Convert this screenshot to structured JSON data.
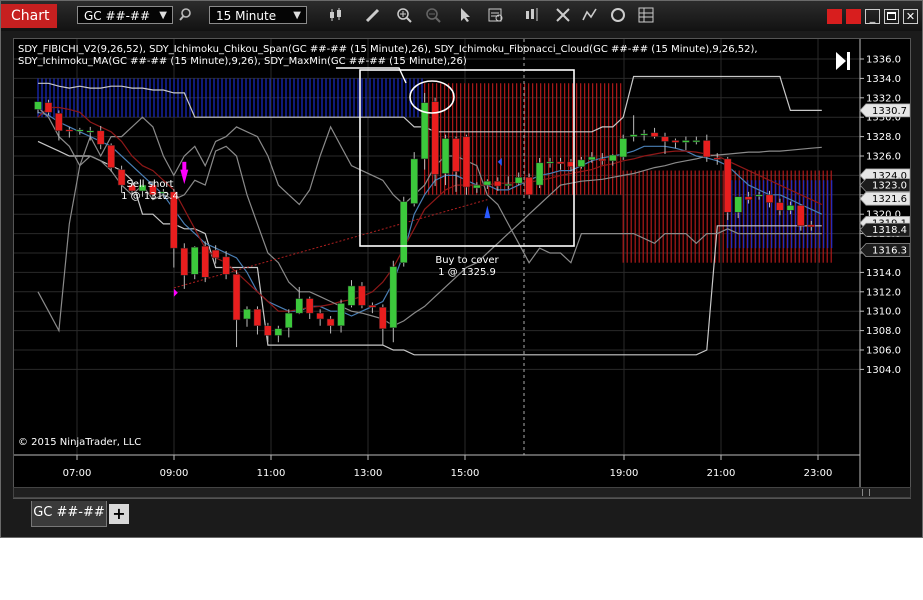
{
  "window": {
    "title": "Chart"
  },
  "toolbar": {
    "instrument": "GC ##-##",
    "interval": "15 Minute",
    "icons": [
      "search-icon",
      "bar-type-icon",
      "pencil-icon",
      "zoom-in-icon",
      "zoom-out-icon",
      "pointer-icon",
      "data-box-icon",
      "chart-style-icon",
      "properties-icon",
      "indicators-icon",
      "reload-icon",
      "grid-menu-icon"
    ]
  },
  "chart": {
    "indicator_label": "SDY_FIBICHI_V2(9,26,52), SDY_Ichimoku_Chikou_Span(GC ##-## (15 Minute),26), SDY_Ichimoku_Fibonacci_Cloud(GC ##-## (15 Minute),9,26,52), SDY_Ichimoku_MA(GC ##-## (15 Minute),9,26), SDY_MaxMin(GC ##-## (15 Minute),26)",
    "copyright": "© 2015 NinjaTrader, LLC",
    "sell_label": "Sell short",
    "sell_fill": "1 @ 1312.4",
    "buy_label": "Buy to cover",
    "buy_fill": "1 @ 1325.9"
  },
  "chart_data": {
    "type": "candlestick",
    "x_tick_labels": [
      "07:00",
      "09:00",
      "11:00",
      "13:00",
      "15:00",
      "19:00",
      "21:00",
      "23:00"
    ],
    "y_tick_labels": [
      "1336.0",
      "1334.0",
      "1332.0",
      "1330.0",
      "1328.0",
      "1326.0",
      "1324.0",
      "1322.0",
      "1320.0",
      "1318.0",
      "1316.0",
      "1314.0",
      "1312.0",
      "1310.0",
      "1308.0",
      "1306.0",
      "1304.0"
    ],
    "ylim": [
      1303.5,
      1337
    ],
    "grid": true,
    "price_markers": [
      {
        "value": 1330.7,
        "label": "1330.7",
        "style": "light"
      },
      {
        "value": 1324.0,
        "label": "1324.0",
        "style": "light"
      },
      {
        "value": 1323.0,
        "label": "1323.0",
        "style": "dark"
      },
      {
        "value": 1321.6,
        "label": "1321.6",
        "style": "light"
      },
      {
        "value": 1319.1,
        "label": "1319.1",
        "style": "light"
      },
      {
        "value": 1318.4,
        "label": "1318.4",
        "style": "dark"
      },
      {
        "value": 1316.3,
        "label": "1316.3",
        "style": "dark"
      }
    ],
    "candles": [
      {
        "o": 1330.8,
        "h": 1331.2,
        "c": 1331.6,
        "l": 1330.4
      },
      {
        "o": 1331.5,
        "h": 1331.8,
        "c": 1330.5,
        "l": 1330.2
      },
      {
        "o": 1330.4,
        "h": 1330.7,
        "c": 1328.6,
        "l": 1327.6
      },
      {
        "o": 1328.7,
        "h": 1329.0,
        "c": 1328.6,
        "l": 1327.9
      },
      {
        "o": 1328.6,
        "h": 1328.9,
        "c": 1328.7,
        "l": 1328.2
      },
      {
        "o": 1328.6,
        "h": 1329.0,
        "c": 1328.6,
        "l": 1327.6
      },
      {
        "o": 1328.6,
        "h": 1329.1,
        "c": 1327.2,
        "l": 1326.7
      },
      {
        "o": 1327.1,
        "h": 1327.3,
        "c": 1324.8,
        "l": 1324.4
      },
      {
        "o": 1324.6,
        "h": 1325.0,
        "c": 1323.0,
        "l": 1322.2
      },
      {
        "o": 1323.0,
        "h": 1323.5,
        "c": 1322.4,
        "l": 1321.9
      },
      {
        "o": 1322.4,
        "h": 1323.0,
        "c": 1323.0,
        "l": 1321.8
      },
      {
        "o": 1323.0,
        "h": 1323.4,
        "c": 1322.0,
        "l": 1321.5
      },
      {
        "o": 1322.2,
        "h": 1322.6,
        "c": 1322.3,
        "l": 1321.7
      },
      {
        "o": 1322.3,
        "h": 1322.6,
        "c": 1316.5,
        "l": 1314.5
      },
      {
        "o": 1316.5,
        "h": 1317.0,
        "c": 1313.7,
        "l": 1312.3
      },
      {
        "o": 1313.8,
        "h": 1316.7,
        "c": 1316.6,
        "l": 1313.3
      },
      {
        "o": 1316.7,
        "h": 1317.2,
        "c": 1313.5,
        "l": 1313.0
      },
      {
        "o": 1316.3,
        "h": 1316.8,
        "c": 1315.5,
        "l": 1314.9
      },
      {
        "o": 1315.6,
        "h": 1316.2,
        "c": 1313.8,
        "l": 1313.3
      },
      {
        "o": 1313.8,
        "h": 1314.2,
        "c": 1309.1,
        "l": 1306.3
      },
      {
        "o": 1309.2,
        "h": 1310.5,
        "c": 1310.2,
        "l": 1308.4
      },
      {
        "o": 1310.2,
        "h": 1310.5,
        "c": 1308.5,
        "l": 1307.6
      },
      {
        "o": 1308.5,
        "h": 1308.8,
        "c": 1307.5,
        "l": 1306.8
      },
      {
        "o": 1307.5,
        "h": 1308.5,
        "c": 1308.2,
        "l": 1306.8
      },
      {
        "o": 1308.3,
        "h": 1310.2,
        "c": 1309.8,
        "l": 1307.3
      },
      {
        "o": 1309.8,
        "h": 1312.5,
        "c": 1311.3,
        "l": 1309.7
      },
      {
        "o": 1311.3,
        "h": 1311.5,
        "c": 1309.8,
        "l": 1309.2
      },
      {
        "o": 1309.8,
        "h": 1310.2,
        "c": 1309.2,
        "l": 1308.5
      },
      {
        "o": 1309.2,
        "h": 1309.5,
        "c": 1308.5,
        "l": 1307.7
      },
      {
        "o": 1308.5,
        "h": 1311.2,
        "c": 1310.8,
        "l": 1307.8
      },
      {
        "o": 1310.6,
        "h": 1313.2,
        "c": 1312.6,
        "l": 1310.4
      },
      {
        "o": 1312.6,
        "h": 1313.0,
        "c": 1310.6,
        "l": 1310.3
      },
      {
        "o": 1310.6,
        "h": 1310.9,
        "c": 1310.4,
        "l": 1309.8
      },
      {
        "o": 1310.4,
        "h": 1310.7,
        "c": 1308.2,
        "l": 1306.5
      },
      {
        "o": 1308.3,
        "h": 1315.2,
        "c": 1314.6,
        "l": 1306.8
      },
      {
        "o": 1315.0,
        "h": 1321.8,
        "c": 1321.3,
        "l": 1314.6
      },
      {
        "o": 1321.1,
        "h": 1326.4,
        "c": 1325.7,
        "l": 1320.8
      },
      {
        "o": 1325.7,
        "h": 1332.5,
        "c": 1331.5,
        "l": 1324.6
      },
      {
        "o": 1331.6,
        "h": 1332.0,
        "c": 1324.1,
        "l": 1322.9
      },
      {
        "o": 1324.2,
        "h": 1328.2,
        "c": 1327.8,
        "l": 1323.0
      },
      {
        "o": 1327.8,
        "h": 1328.0,
        "c": 1324.4,
        "l": 1322.3
      },
      {
        "o": 1328.0,
        "h": 1328.2,
        "c": 1322.8,
        "l": 1322.0
      },
      {
        "o": 1322.7,
        "h": 1323.3,
        "c": 1323.0,
        "l": 1322.2
      },
      {
        "o": 1323.0,
        "h": 1323.6,
        "c": 1323.4,
        "l": 1322.6
      },
      {
        "o": 1323.4,
        "h": 1323.8,
        "c": 1322.9,
        "l": 1322.4
      },
      {
        "o": 1323.1,
        "h": 1323.9,
        "c": 1323.1,
        "l": 1322.6
      },
      {
        "o": 1323.2,
        "h": 1324.3,
        "c": 1323.8,
        "l": 1323.0
      },
      {
        "o": 1323.8,
        "h": 1324.2,
        "c": 1322.0,
        "l": 1321.6
      },
      {
        "o": 1323.0,
        "h": 1325.8,
        "c": 1325.3,
        "l": 1322.7
      },
      {
        "o": 1325.3,
        "h": 1325.8,
        "c": 1325.4,
        "l": 1324.8
      },
      {
        "o": 1325.4,
        "h": 1325.8,
        "c": 1325.2,
        "l": 1324.6
      },
      {
        "o": 1325.4,
        "h": 1325.7,
        "c": 1324.9,
        "l": 1324.4
      },
      {
        "o": 1324.9,
        "h": 1325.9,
        "c": 1325.6,
        "l": 1324.7
      },
      {
        "o": 1325.6,
        "h": 1326.4,
        "c": 1325.9,
        "l": 1325.3
      },
      {
        "o": 1325.7,
        "h": 1326.3,
        "c": 1325.5,
        "l": 1325.1
      },
      {
        "o": 1325.5,
        "h": 1326.2,
        "c": 1326.1,
        "l": 1325.0
      },
      {
        "o": 1325.9,
        "h": 1328.2,
        "c": 1327.8,
        "l": 1325.6
      },
      {
        "o": 1328.0,
        "h": 1330.2,
        "c": 1328.2,
        "l": 1327.5
      },
      {
        "o": 1328.2,
        "h": 1328.7,
        "c": 1328.3,
        "l": 1327.6
      },
      {
        "o": 1328.4,
        "h": 1328.9,
        "c": 1328.0,
        "l": 1327.8
      },
      {
        "o": 1328.0,
        "h": 1328.4,
        "c": 1327.5,
        "l": 1326.2
      },
      {
        "o": 1327.6,
        "h": 1327.8,
        "c": 1327.4,
        "l": 1326.8
      },
      {
        "o": 1327.4,
        "h": 1328.0,
        "c": 1327.6,
        "l": 1326.6
      },
      {
        "o": 1327.6,
        "h": 1328.0,
        "c": 1327.6,
        "l": 1327.2
      },
      {
        "o": 1327.6,
        "h": 1328.2,
        "c": 1325.9,
        "l": 1325.4
      },
      {
        "o": 1325.8,
        "h": 1326.3,
        "c": 1325.7,
        "l": 1325.1
      },
      {
        "o": 1325.7,
        "h": 1325.9,
        "c": 1320.2,
        "l": 1319.4
      },
      {
        "o": 1320.2,
        "h": 1321.8,
        "c": 1321.8,
        "l": 1319.6
      },
      {
        "o": 1321.8,
        "h": 1322.3,
        "c": 1321.5,
        "l": 1321.1
      },
      {
        "o": 1321.9,
        "h": 1322.3,
        "c": 1322.0,
        "l": 1321.5
      },
      {
        "o": 1322.0,
        "h": 1322.4,
        "c": 1321.2,
        "l": 1320.7
      },
      {
        "o": 1321.2,
        "h": 1321.6,
        "c": 1320.4,
        "l": 1319.9
      },
      {
        "o": 1320.4,
        "h": 1321.3,
        "c": 1320.9,
        "l": 1320.0
      },
      {
        "o": 1320.9,
        "h": 1321.0,
        "c": 1318.8,
        "l": 1318.3
      },
      {
        "o": 1318.9,
        "h": 1319.3,
        "c": 1318.7,
        "l": 1318.3
      }
    ],
    "series": [
      {
        "style": "light-gray",
        "values": [
          1333.5,
          1333.5,
          1333.2,
          1333.0,
          1333.2,
          1333.0,
          1333.0,
          1333.2,
          1333.2,
          1333.0,
          1333.0,
          1332.8,
          1332.8,
          1332.5,
          1332.5,
          1330.0,
          1330.0,
          1330.0,
          1330.0,
          1330.0,
          1330.0,
          1330.0,
          1330.0,
          1330.0,
          1330.0,
          1330.0,
          1330.0,
          1330.0,
          1330.0,
          1330.0,
          1330.0,
          1330.0,
          1330.0,
          1330.0,
          1330.0,
          1330.0,
          1329.0,
          1329.0,
          1328.5,
          1328.5,
          1328.5,
          1328.5,
          1328.5,
          1328.5,
          1328.5,
          1328.5,
          1328.5,
          1328.5,
          1328.5,
          1328.5,
          1328.5,
          1328.5,
          1328.5,
          1328.5,
          1329.0,
          1329.0,
          1330.0,
          1334.2,
          1334.2,
          1334.2,
          1334.2,
          1334.2,
          1334.2,
          1334.2,
          1334.2,
          1334.2,
          1334.2,
          1334.2,
          1334.2,
          1334.2,
          1334.2,
          1334.2,
          1330.7,
          1330.7,
          1330.7,
          1330.7
        ]
      },
      {
        "style": "light-gray",
        "values": [
          1327.5,
          1327.0,
          1326.5,
          1326.0,
          1326.0,
          1326.0,
          1325.5,
          1325.0,
          1324.5,
          1323.5,
          1320.0,
          1320.0,
          1319.0,
          1319.0,
          1318.5,
          1318.5,
          1318.0,
          1314.5,
          1314.5,
          1314.5,
          1314.5,
          1314.5,
          1306.5,
          1306.5,
          1306.5,
          1306.5,
          1306.5,
          1306.5,
          1306.5,
          1306.5,
          1306.5,
          1306.5,
          1306.5,
          1306.5,
          1306.0,
          1306.0,
          1305.5,
          1305.5,
          1305.5,
          1305.5,
          1305.5,
          1305.5,
          1305.5,
          1305.5,
          1305.5,
          1305.5,
          1305.5,
          1305.5,
          1305.5,
          1305.5,
          1305.5,
          1305.5,
          1305.5,
          1305.5,
          1305.5,
          1305.5,
          1305.5,
          1305.5,
          1305.5,
          1305.5,
          1305.5,
          1305.5,
          1305.5,
          1305.5,
          1306.0,
          1318.8,
          1318.8,
          1318.8,
          1318.8,
          1318.8,
          1318.8,
          1318.8,
          1318.8,
          1318.8,
          1318.8,
          1318.8
        ]
      },
      {
        "style": "gray",
        "values": [
          1312.0,
          1310.0,
          1308.0,
          1319.0,
          1325.0,
          1328.0,
          1326.0,
          1328.0,
          1328.0,
          1329.0,
          1330.0,
          1329.0,
          1326.0,
          1324.0,
          1326.0,
          1327.0,
          1325.0,
          1327.5,
          1328.0,
          1329.0,
          1328.5,
          1328.0,
          1326.0,
          1323.0,
          1322.0,
          1321.0,
          1322.5,
          1326.0,
          1329.0,
          1327.0,
          1325.0,
          1324.5,
          1324.0,
          1323.5,
          1322.0,
          1321.0,
          1322.0,
          1323.0,
          1325.0,
          1326.0,
          1326.0,
          1325.5,
          1325.0,
          1322.0,
          1321.0,
          1319.0,
          1317.0,
          1315.0,
          1316.5,
          1316.0,
          1316.0,
          1315.0,
          1318.0,
          1318.0,
          1318.0,
          1318.0,
          1318.0,
          1318.0,
          1317.5,
          1317.0,
          1318.0,
          1318.0,
          1318.0,
          1317.0,
          1318.0,
          1318.0,
          1318.5,
          1318.0,
          1318.0,
          1318.0,
          1318.0,
          1318.0,
          1318.0,
          1318.0,
          1318.0,
          1318.0
        ]
      },
      {
        "style": "blue",
        "values": [
          1330.5,
          1330.2,
          1329.5,
          1329.0,
          1328.5,
          1328.0,
          1327.5,
          1327.0,
          1326.0,
          1325.0,
          1324.0,
          1323.0,
          1322.0,
          1320.5,
          1319.0,
          1318.0,
          1317.0,
          1316.5,
          1316.0,
          1315.5,
          1314.0,
          1312.0,
          1311.0,
          1310.5,
          1310.0,
          1310.0,
          1310.5,
          1310.5,
          1310.0,
          1310.0,
          1309.5,
          1310.0,
          1310.5,
          1311.0,
          1313.0,
          1316.0,
          1320.0,
          1322.0,
          1323.5,
          1324.0,
          1324.0,
          1323.5,
          1323.0,
          1323.0,
          1322.5,
          1322.5,
          1323.0,
          1323.5,
          1324.0,
          1324.2,
          1324.5,
          1324.5,
          1325.0,
          1325.5,
          1325.8,
          1326.0,
          1326.2,
          1326.5,
          1327.0,
          1327.0,
          1327.0,
          1326.8,
          1326.5,
          1326.0,
          1325.8,
          1325.5,
          1325.0,
          1324.0,
          1323.0,
          1322.5,
          1322.0,
          1322.0,
          1321.5,
          1321.0,
          1320.5,
          1320.0
        ]
      },
      {
        "style": "dark-red",
        "values": [
          1330.0,
          1331.0,
          1331.0,
          1330.8,
          1330.5,
          1329.5,
          1329.0,
          1328.5,
          1327.5,
          1326.0,
          1325.0,
          1324.5,
          1323.5,
          1322.5,
          1320.5,
          1318.5,
          1316.5,
          1315.5,
          1315.0,
          1314.0,
          1313.0,
          1312.0,
          1311.0,
          1310.0,
          1310.0,
          1310.2,
          1310.4,
          1310.5,
          1310.7,
          1311.0,
          1311.2,
          1311.5,
          1312.0,
          1313.0,
          1314.5,
          1316.5,
          1318.5,
          1320.5,
          1321.5,
          1322.5,
          1323.0,
          1323.0,
          1323.0,
          1323.0,
          1323.2,
          1323.2,
          1323.3,
          1323.3,
          1323.5,
          1323.7,
          1324.0,
          1324.2,
          1324.4,
          1324.6,
          1325.0,
          1325.2,
          1325.5,
          1325.7,
          1326.0,
          1326.2,
          1326.4,
          1326.5,
          1326.5,
          1326.4,
          1326.2,
          1326.0,
          1325.5,
          1325.0,
          1324.5,
          1324.0,
          1323.5,
          1323.0,
          1322.5,
          1322.0,
          1321.5,
          1321.0
        ]
      },
      {
        "style": "gray",
        "values": [
          1331.0,
          1330.0,
          1328.0,
          1327.0,
          1325.0,
          1326.0,
          1325.5,
          1324.5,
          1323.0,
          1322.0,
          1323.0,
          1321.5,
          1322.0,
          1321.5,
          1322.0,
          1323.5,
          1323.0,
          1326.5,
          1327.0,
          1326.0,
          1322.0,
          1319.0,
          1316.0,
          1315.0,
          1313.0,
          1312.0,
          1312.0,
          1311.5,
          1311.0,
          1310.5,
          1310.0,
          1309.8,
          1309.5,
          1309.2,
          1308.5,
          1309.0,
          1309.8,
          1310.5,
          1311.5,
          1312.5,
          1313.5,
          1314.5,
          1315.0,
          1316.0,
          1317.0,
          1318.0,
          1319.0,
          1320.0,
          1321.0,
          1322.0,
          1323.0,
          1323.2,
          1323.4,
          1323.5,
          1323.6,
          1323.8,
          1324.0,
          1324.2,
          1324.5,
          1324.8,
          1325.0,
          1325.3,
          1325.5,
          1325.7,
          1326.0,
          1326.1,
          1326.2,
          1326.3,
          1326.4,
          1326.4,
          1326.5,
          1326.5,
          1326.6,
          1326.7,
          1326.8,
          1326.9
        ]
      }
    ],
    "cloud_bands": [
      {
        "color": "blue",
        "x_start_index": 0,
        "x_end_index": 37,
        "upper": 1334.0,
        "lower": 1330.0
      },
      {
        "color": "red",
        "x_start_index": 37,
        "x_end_index": 56,
        "upper": 1333.5,
        "lower": 1322.0
      },
      {
        "color": "red",
        "x_start_index": 56,
        "x_end_index": 76,
        "upper": 1324.5,
        "lower": 1315.0
      },
      {
        "color": "blue",
        "x_start_index": 66,
        "x_end_index": 76,
        "upper": 1323.5,
        "lower": 1316.5
      }
    ]
  }
}
